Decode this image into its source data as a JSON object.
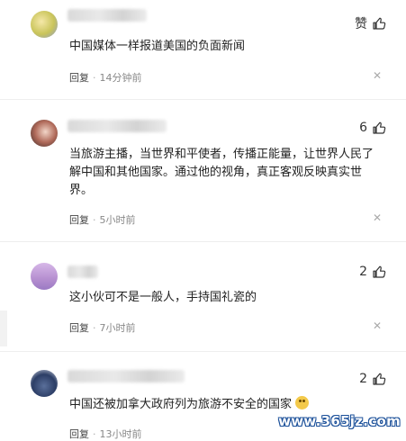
{
  "comments": [
    {
      "text": "中国媒体一样报道美国的负面新闻",
      "like": "赞",
      "reply": "回复",
      "time": "14分钟前"
    },
    {
      "text": "当旅游主播，当世界和平使者，传播正能量，让世界人民了解中国和其他国家。通过他的视角，真正客观反映真实世界。",
      "like": "6",
      "reply": "回复",
      "time": "5小时前"
    },
    {
      "text": "这小伙可不是一般人，手持国礼瓷的",
      "like": "2",
      "reply": "回复",
      "time": "7小时前"
    },
    {
      "text": "中国还被加拿大政府列为旅游不安全的国家",
      "like": "2",
      "reply": "回复",
      "time": "13小时前"
    }
  ],
  "watermark": "www.365jz.com",
  "colors": {
    "text": "#222222",
    "meta": "#888888",
    "watermark_outline": "#1a4f99"
  }
}
